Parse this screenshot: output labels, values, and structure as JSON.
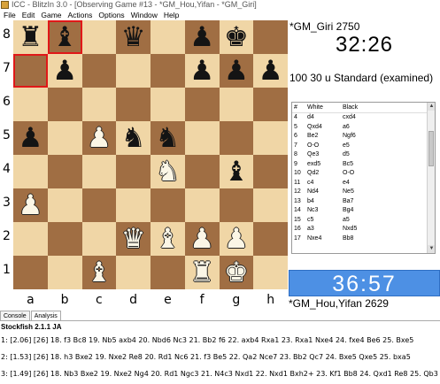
{
  "window": {
    "title": "ICC - BlitzIn 3.0 - [Observing Game #13 - *GM_Hou,Yifan - *GM_Giri]"
  },
  "menu": [
    "File",
    "Edit",
    "Game",
    "Actions",
    "Options",
    "Window",
    "Help"
  ],
  "board": {
    "ranks": [
      "8",
      "7",
      "6",
      "5",
      "4",
      "3",
      "2",
      "1"
    ],
    "files": [
      "a",
      "b",
      "c",
      "d",
      "e",
      "f",
      "g",
      "h"
    ],
    "highlight": [
      "b8",
      "a7"
    ],
    "position": [
      [
        "r",
        "b",
        "",
        "q",
        "",
        "p",
        "k",
        ""
      ],
      [
        "",
        "p",
        "",
        "",
        "",
        "p",
        "p",
        "p"
      ],
      [
        "",
        "",
        "",
        "",
        "",
        "",
        "",
        ""
      ],
      [
        "p",
        "",
        "P",
        "n",
        "n",
        "",
        "",
        ""
      ],
      [
        "",
        "",
        "",
        "",
        "N",
        "",
        "b",
        ""
      ],
      [
        "P",
        "",
        "",
        "",
        "",
        "",
        "",
        ""
      ],
      [
        "",
        "",
        "",
        "Q",
        "B",
        "P",
        "P",
        ""
      ],
      [
        "",
        "",
        "B",
        "",
        "",
        "R",
        "K",
        ""
      ]
    ]
  },
  "top_player": {
    "name": "*GM_Giri 2750",
    "clock": "32:26"
  },
  "game_info": "100 30 u Standard (examined)",
  "moves": {
    "headers": {
      "num": "#",
      "white": "White",
      "black": "Black"
    },
    "rows": [
      {
        "n": "4",
        "w": "d4",
        "b": "cxd4"
      },
      {
        "n": "5",
        "w": "Qxd4",
        "b": "a6"
      },
      {
        "n": "6",
        "w": "Be2",
        "b": "Ngf6"
      },
      {
        "n": "7",
        "w": "O-O",
        "b": "e5"
      },
      {
        "n": "8",
        "w": "Qe3",
        "b": "d5"
      },
      {
        "n": "9",
        "w": "exd5",
        "b": "Bc5"
      },
      {
        "n": "10",
        "w": "Qd2",
        "b": "O-O"
      },
      {
        "n": "11",
        "w": "c4",
        "b": "e4"
      },
      {
        "n": "12",
        "w": "Nd4",
        "b": "Ne5"
      },
      {
        "n": "13",
        "w": "b4",
        "b": "Ba7"
      },
      {
        "n": "14",
        "w": "Nc3",
        "b": "Bg4"
      },
      {
        "n": "15",
        "w": "c5",
        "b": "a5"
      },
      {
        "n": "16",
        "w": "a3",
        "b": "Nxd5"
      },
      {
        "n": "17",
        "w": "Nxe4",
        "b": "Bb8"
      }
    ]
  },
  "bottom_player": {
    "name": "*GM_Hou,Yifan 2629",
    "clock": "36:57"
  },
  "tabs": [
    "Console",
    "Analysis"
  ],
  "analysis": {
    "engine": "Stockfish 2.1.1 JA",
    "lines": [
      "1: [2.06] [26] 18. f3 Bc8 19. Nb5 axb4 20. Nbd6 Nc3 21. Bb2 f6 22. axb4 Rxa1 23. Rxa1 Nxe4 24. fxe4 Be6 25. Bxe5",
      "2: [1.53] [26] 18. h3 Bxe2 19. Nxe2 Re8 20. Rd1 Nc6 21. f3 Be5 22. Qa2 Nce7 23. Bb2 Qc7 24. Bxe5 Qxe5 25. bxa5",
      "3: [1.49] [26] 18. Nb3 Bxe2 19. Nxe2 Ng4 20. Rd1 Ngc3 21. N4c3 Nxd1 22. Nxd1 Bxh2+ 23. Kf1 Bb8 24. Qxd1 Re8 25. Qb3"
    ]
  },
  "colors": {
    "light_square": "#f0d6a6",
    "dark_square": "#a06e43",
    "highlight": "#e01818",
    "active_clock": "#4d90e4"
  },
  "icons": {
    "app": "blitzin-app-icon",
    "scroll_up": "scroll-up-arrow-icon",
    "scroll_down": "scroll-down-arrow-icon"
  }
}
